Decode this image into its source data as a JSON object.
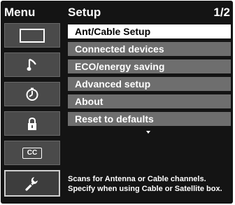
{
  "menu": {
    "title": "Menu",
    "items": [
      {
        "icon": "picture-icon"
      },
      {
        "icon": "music-note-icon"
      },
      {
        "icon": "timer-icon"
      },
      {
        "icon": "lock-icon"
      },
      {
        "icon": "closed-caption-icon",
        "label": "CC"
      },
      {
        "icon": "setup-wrench-icon"
      }
    ],
    "selected_index": 5
  },
  "setup": {
    "title": "Setup",
    "page": "1/2",
    "options": [
      "Ant/Cable Setup",
      "Connected devices",
      "ECO/energy saving",
      "Advanced setup",
      "About",
      "Reset to defaults"
    ],
    "selected_index": 0,
    "help_lines": [
      "Scans for Antenna or Cable channels.",
      "Specify when using Cable or Satellite box."
    ]
  },
  "colors": {
    "background": "#141414",
    "option_bg": "#6e6e6e",
    "selected_bg": "#ffffff",
    "menu_item_bg": "#4a4a4a"
  }
}
